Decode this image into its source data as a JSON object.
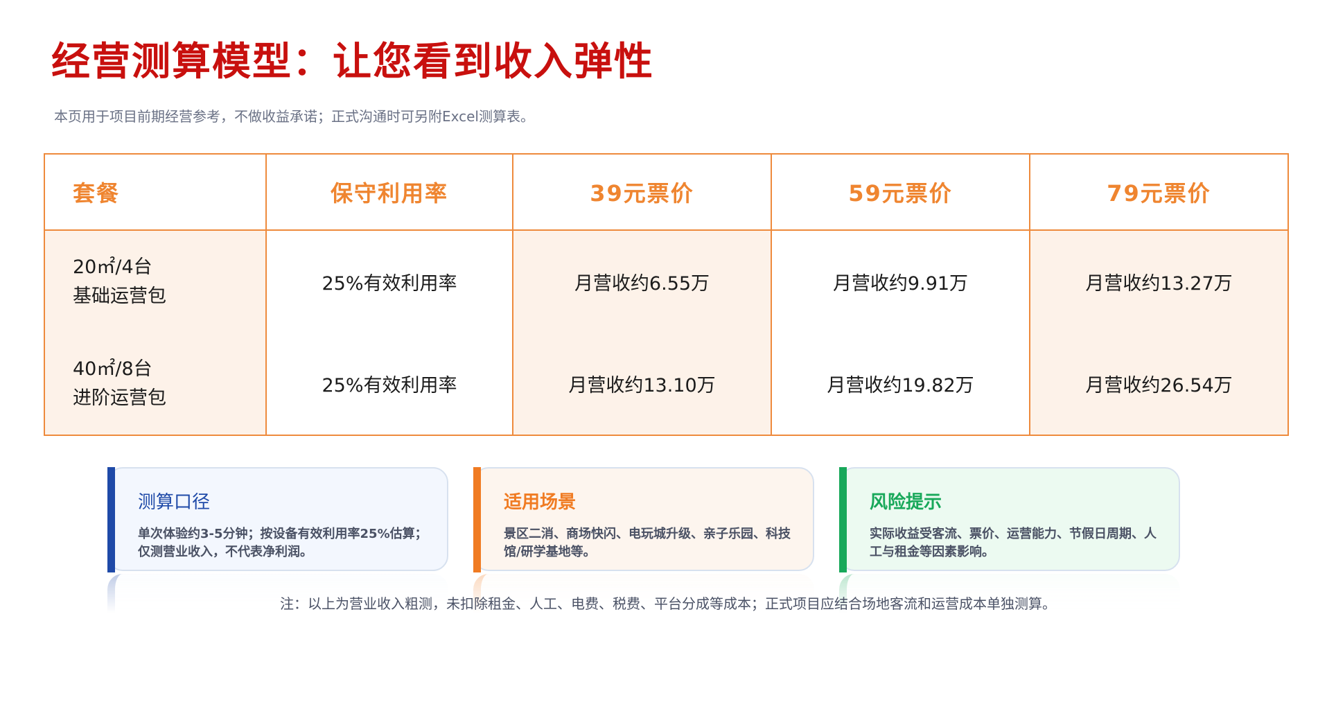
{
  "title": "经营测算模型：让您看到收入弹性",
  "subtitle": "本页用于项目前期经营参考，不做收益承诺；正式沟通时可另附Excel测算表。",
  "table": {
    "headers": [
      "套餐",
      "保守利用率",
      "39元票价",
      "59元票价",
      "79元票价"
    ],
    "rows": [
      {
        "package_line1": "20㎡/4台",
        "package_line2": "基础运营包",
        "utilization": "25%有效利用率",
        "rev_39": "月营收约6.55万",
        "rev_59": "月营收约9.91万",
        "rev_79": "月营收约13.27万"
      },
      {
        "package_line1": "40㎡/8台",
        "package_line2": "进阶运营包",
        "utilization": "25%有效利用率",
        "rev_39": "月营收约13.10万",
        "rev_59": "月营收约19.82万",
        "rev_79": "月营收约26.54万"
      }
    ]
  },
  "cards": [
    {
      "title": "测算口径",
      "body": "单次体验约3-5分钟；按设备有效利用率25%估算；仅测营业收入，不代表净利润。",
      "accent": "#1f4aa8",
      "bg": "#f3f7fe"
    },
    {
      "title": "适用场景",
      "body": "景区二消、商场快闪、电玩城升级、亲子乐园、科技馆/研学基地等。",
      "accent": "#f07b22",
      "bg": "#fdf5ee"
    },
    {
      "title": "风险提示",
      "body": "实际收益受客流、票价、运营能力、节假日周期、人工与租金等因素影响。",
      "accent": "#18a85a",
      "bg": "#ecfaf1"
    }
  ],
  "note": "注：以上为营业收入粗测，未扣除租金、人工、电费、税费、平台分成等成本；正式项目应结合场地客流和运营成本单独测算。",
  "colors": {
    "title": "#c8100e",
    "table_border": "#ee8a3c",
    "header_text": "#ef8530",
    "cell_peach": "#fdf2e9"
  }
}
